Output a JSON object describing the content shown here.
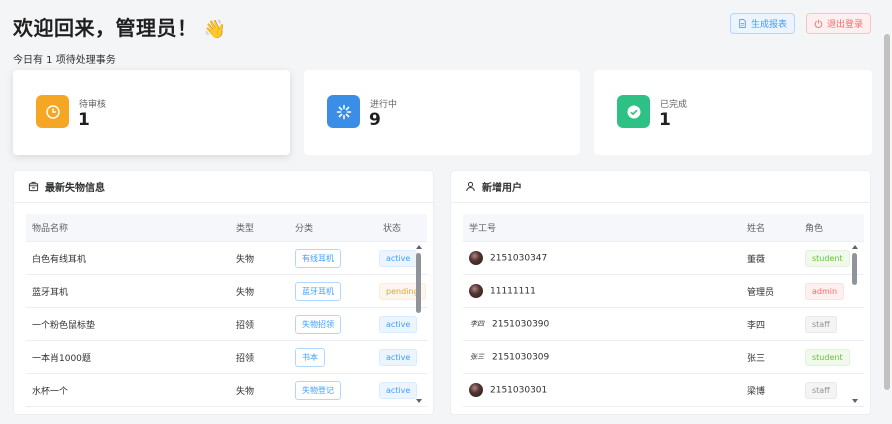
{
  "header": {
    "welcome": "欢迎回来，管理员！",
    "wave_emoji": "👋",
    "subtitle": "今日有 1 项待处理事务",
    "report_button": "生成报表",
    "logout_button": "退出登录"
  },
  "stats": [
    {
      "label": "待审核",
      "value": "1",
      "color": "#f5a623",
      "icon": "clock-icon"
    },
    {
      "label": "进行中",
      "value": "9",
      "color": "#3a8ee6",
      "icon": "loading-icon"
    },
    {
      "label": "已完成",
      "value": "1",
      "color": "#2ec185",
      "icon": "check-circle-icon"
    }
  ],
  "lost_panel": {
    "title": "最新失物信息",
    "columns": [
      "物品名称",
      "类型",
      "分类",
      "状态"
    ],
    "rows": [
      {
        "name": "白色有线耳机",
        "type": "失物",
        "category": "有线耳机",
        "status": "active"
      },
      {
        "name": "蓝牙耳机",
        "type": "失物",
        "category": "蓝牙耳机",
        "status": "pending"
      },
      {
        "name": "一个粉色鼠标垫",
        "type": "招领",
        "category": "失物招领",
        "status": "active"
      },
      {
        "name": "一本肖1000题",
        "type": "招领",
        "category": "书本",
        "status": "active"
      },
      {
        "name": "水杯一个",
        "type": "失物",
        "category": "失物登记",
        "status": "active"
      }
    ]
  },
  "users_panel": {
    "title": "新增用户",
    "columns": [
      "学工号",
      "姓名",
      "角色"
    ],
    "rows": [
      {
        "id": "2151030347",
        "name": "董薇",
        "role": "student",
        "avatar": "photo"
      },
      {
        "id": "11111111",
        "name": "管理员",
        "role": "admin",
        "avatar": "photo"
      },
      {
        "id": "2151030390",
        "name": "李四",
        "role": "staff",
        "avatar": "signature",
        "sig_text": "李四"
      },
      {
        "id": "2151030309",
        "name": "张三",
        "role": "student",
        "avatar": "signature",
        "sig_text": "张三"
      },
      {
        "id": "2151030301",
        "name": "梁博",
        "role": "staff",
        "avatar": "photo"
      }
    ]
  }
}
